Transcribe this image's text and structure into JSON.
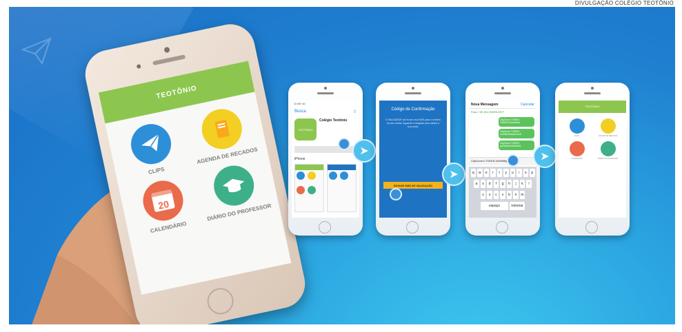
{
  "caption": "DIVULGAÇÃO COLÉGIO TEOTÔNIO",
  "colors": {
    "banner_blue": "#1f7fd0",
    "app_green": "#8dc64f",
    "clips_blue": "#2d8fd8",
    "agenda_yellow": "#f2cf22",
    "calendar_red": "#ea6a4c",
    "diario_teal": "#3db08a",
    "validation_button": "#f2b31d"
  },
  "big_phone": {
    "brand": "TEOTÔNIO",
    "tiles": [
      {
        "label": "CLIPS",
        "icon": "paper-plane-icon",
        "color": "#2d8fd8"
      },
      {
        "label": "AGENDA DE RECADOS",
        "icon": "notebook-icon",
        "color": "#f2cf22"
      },
      {
        "label": "CALENDÁRIO",
        "icon": "calendar-icon",
        "color": "#ea6a4c",
        "day": "20"
      },
      {
        "label": "DIÁRIO DO PROFESSOR",
        "icon": "graduation-cap-icon",
        "color": "#3db08a"
      }
    ]
  },
  "steps": {
    "phone1": {
      "status": "Oi BR 4G",
      "back_label": "Busca",
      "app_name": "Colégio Teotônio",
      "brand": "TEOTÔNIO",
      "section": "iPhone"
    },
    "phone2": {
      "title": "Código de Confirmação",
      "body": "O VALIDADOR vai enviar uma SMS para o número do seu celular. Aguarde a chegada para validar a sua conta.",
      "button_label": "ENVIAR SMS DE VALIDAÇÃO"
    },
    "phone3": {
      "title": "Nova Mensagem",
      "cancel_label": "Cancelar",
      "to_line": "Para: +55 (91) 99999-9977",
      "messages": [
        "ClipZoom TOKEN 2369b761f3cf4bdb",
        "ClipZoom TOKEN ec3d5e26aa3a1e15",
        "ClipZoom TOKEN ge3d6b4rbb6b3d43"
      ],
      "input_text": "ClipZoom's TOKEN 2m989tfg4b0f3f8b",
      "keyboard_rows": [
        [
          "q",
          "w",
          "e",
          "r",
          "t",
          "y",
          "u",
          "i",
          "o",
          "p"
        ],
        [
          "a",
          "s",
          "d",
          "f",
          "g",
          "h",
          "j",
          "k",
          "l"
        ],
        [
          "z",
          "x",
          "c",
          "v",
          "b",
          "n",
          "m"
        ]
      ],
      "space_label": "espaço",
      "return_label": "retornar"
    },
    "phone4": {
      "brand": "TEOTÔNIO"
    }
  }
}
